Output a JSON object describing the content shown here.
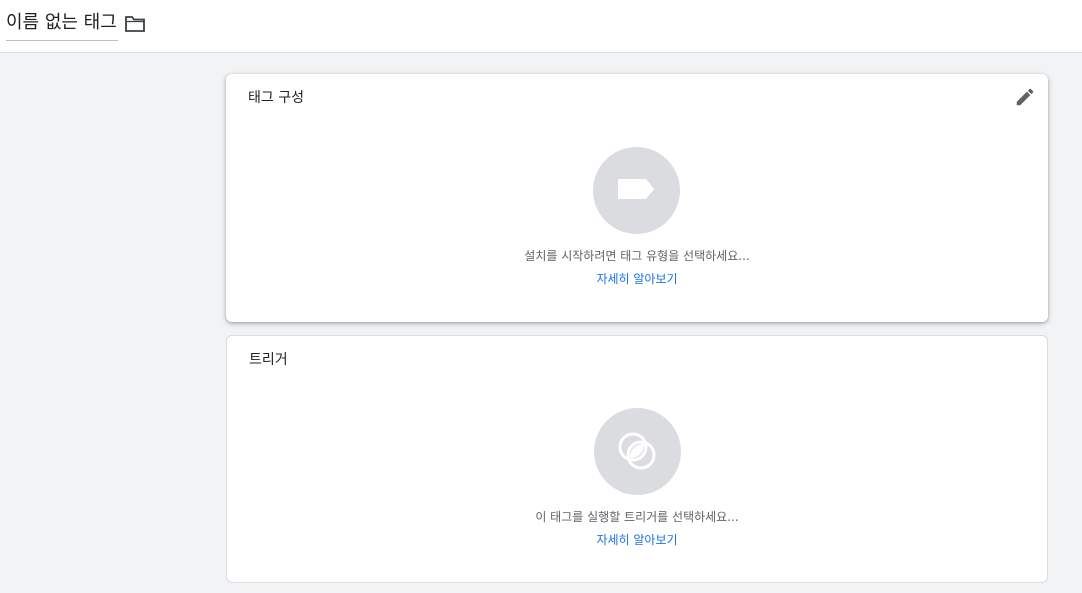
{
  "header": {
    "title": "이름 없는 태그",
    "folder_icon": "folder-icon"
  },
  "tag_config": {
    "title": "태그 구성",
    "edit_icon": "pencil-icon",
    "placeholder_icon": "tag-icon",
    "hint": "설치를 시작하려면 태그 유형을 선택하세요...",
    "link": "자세히 알아보기"
  },
  "trigger": {
    "title": "트리거",
    "placeholder_icon": "trigger-icon",
    "hint": "이 태그를 실행할 트리거를 선택하세요...",
    "link": "자세히 알아보기"
  },
  "colors": {
    "background": "#f1f3f4",
    "link": "#1a73e8",
    "icon_circle": "#dadce0"
  }
}
